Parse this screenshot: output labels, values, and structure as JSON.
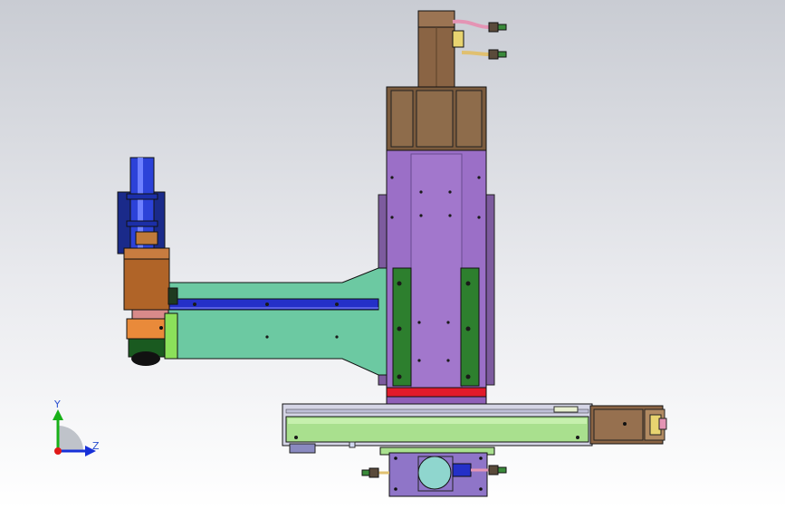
{
  "view": {
    "axes": {
      "y_label": "Y",
      "z_label": "Z",
      "colors": {
        "y_axis": "#18b018",
        "z_axis": "#1730d8",
        "x_axis": "#e01818"
      }
    }
  },
  "colors": {
    "background_top": "#c9ccd3",
    "background_bottom": "#ffffff",
    "column_purple": "#9b6fc7",
    "motor_brown": "#8a6444",
    "arm_teal": "#6cc9a2",
    "rail_green": "#a9e08e",
    "guide_dark_green": "#2d7f2e",
    "blue_strip": "#2430c8",
    "red_stop": "#e11a2a"
  },
  "components": [
    {
      "name": "top-servo-motor",
      "icon": "motor-icon"
    },
    {
      "name": "vertical-column",
      "icon": "column-icon"
    },
    {
      "name": "horizontal-arm",
      "icon": "arm-icon"
    },
    {
      "name": "left-rotary-head",
      "icon": "gripper-icon"
    },
    {
      "name": "bottom-linear-rail",
      "icon": "rail-icon"
    },
    {
      "name": "right-rail-motor",
      "icon": "motor-icon"
    },
    {
      "name": "bottom-carriage-motor",
      "icon": "motor-icon"
    }
  ]
}
